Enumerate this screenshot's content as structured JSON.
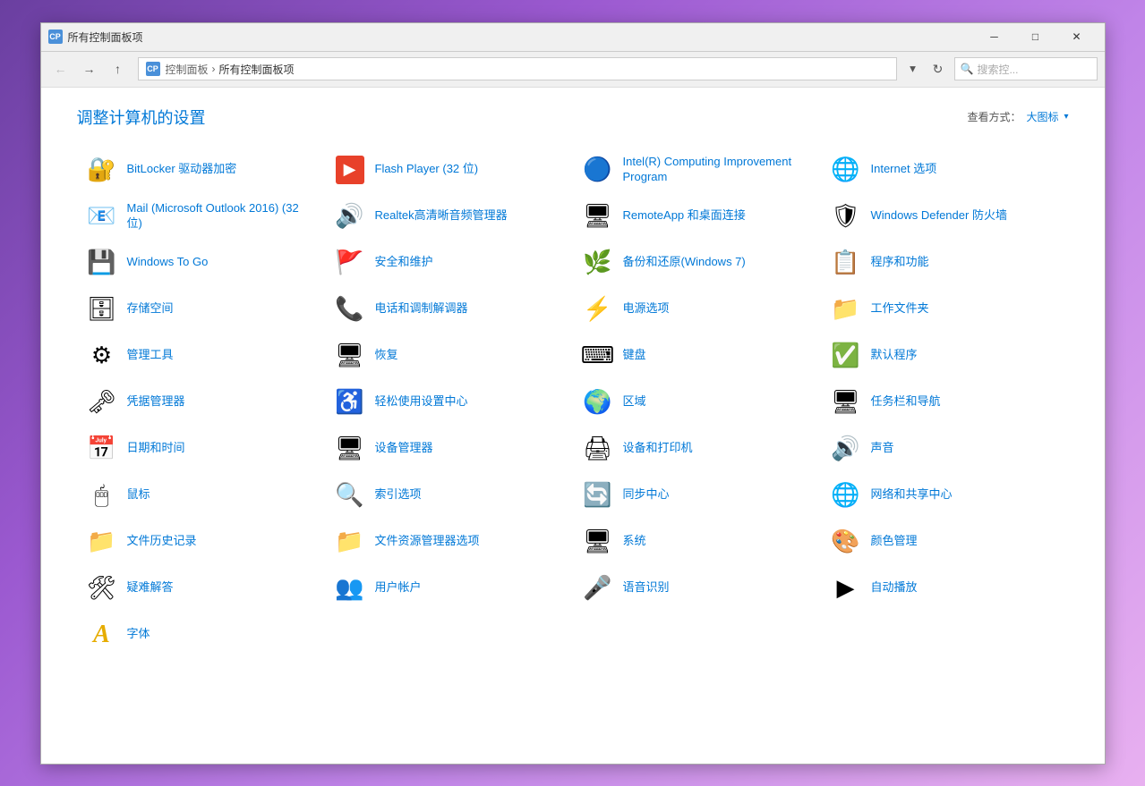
{
  "window": {
    "title": "所有控制面板项",
    "titlebar_icon": "CP"
  },
  "titlebar_buttons": {
    "minimize": "─",
    "maximize": "□",
    "close": "✕"
  },
  "toolbar": {
    "back": "←",
    "forward": "→",
    "up": "↑",
    "address_icon": "CP",
    "breadcrumb1": "控制面板",
    "breadcrumb2": "所有控制面板项",
    "dropdown": "▾",
    "refresh": "↻",
    "search_placeholder": "搜索控..."
  },
  "header": {
    "title": "调整计算机的设置",
    "view_label": "查看方式：",
    "view_mode": "大图标",
    "view_chevron": "▾"
  },
  "items": [
    {
      "label": "BitLocker 驱动器加密",
      "icon": "🔐",
      "icon_color": "#666"
    },
    {
      "label": "Flash Player (32 位)",
      "icon": "▶",
      "icon_color": "#e8412a",
      "icon_bg": "#e8412a"
    },
    {
      "label": "Intel(R) Computing Improvement Program",
      "icon": "🔵",
      "icon_color": "#0071c5"
    },
    {
      "label": "Internet 选项",
      "icon": "🌐",
      "icon_color": "#1e88e5"
    },
    {
      "label": "Mail (Microsoft Outlook 2016) (32 位)",
      "icon": "📧",
      "icon_color": "#0078d4"
    },
    {
      "label": "Realtek高清晰音频管理器",
      "icon": "🔊",
      "icon_color": "#e65c00"
    },
    {
      "label": "RemoteApp 和桌面连接",
      "icon": "🖥",
      "icon_color": "#0078d4"
    },
    {
      "label": "Windows Defender 防火墙",
      "icon": "🛡",
      "icon_color": "#d4a000"
    },
    {
      "label": "Windows To Go",
      "icon": "💾",
      "icon_color": "#0078d4"
    },
    {
      "label": "安全和维护",
      "icon": "🚩",
      "icon_color": "#cc0000"
    },
    {
      "label": "备份和还原(Windows 7)",
      "icon": "🌿",
      "icon_color": "#4caf50"
    },
    {
      "label": "程序和功能",
      "icon": "📋",
      "icon_color": "#888"
    },
    {
      "label": "存储空间",
      "icon": "🗄",
      "icon_color": "#0078d4"
    },
    {
      "label": "电话和调制解调器",
      "icon": "📞",
      "icon_color": "#666"
    },
    {
      "label": "电源选项",
      "icon": "⚡",
      "icon_color": "#4caf50"
    },
    {
      "label": "工作文件夹",
      "icon": "📁",
      "icon_color": "#e6ac00"
    },
    {
      "label": "管理工具",
      "icon": "⚙",
      "icon_color": "#666"
    },
    {
      "label": "恢复",
      "icon": "🖥",
      "icon_color": "#0078d4"
    },
    {
      "label": "键盘",
      "icon": "⌨",
      "icon_color": "#888"
    },
    {
      "label": "默认程序",
      "icon": "✅",
      "icon_color": "#4caf50"
    },
    {
      "label": "凭据管理器",
      "icon": "🗝",
      "icon_color": "#c8a800"
    },
    {
      "label": "轻松使用设置中心",
      "icon": "♿",
      "icon_color": "#0078d7"
    },
    {
      "label": "区域",
      "icon": "🌍",
      "icon_color": "#1e88e5"
    },
    {
      "label": "任务栏和导航",
      "icon": "🖥",
      "icon_color": "#555"
    },
    {
      "label": "日期和时间",
      "icon": "📅",
      "icon_color": "#0078d4"
    },
    {
      "label": "设备管理器",
      "icon": "🖥",
      "icon_color": "#0078d4"
    },
    {
      "label": "设备和打印机",
      "icon": "🖨",
      "icon_color": "#666"
    },
    {
      "label": "声音",
      "icon": "🔊",
      "icon_color": "#888"
    },
    {
      "label": "鼠标",
      "icon": "🖱",
      "icon_color": "#555"
    },
    {
      "label": "索引选项",
      "icon": "🔍",
      "icon_color": "#0078d4"
    },
    {
      "label": "同步中心",
      "icon": "🔄",
      "icon_color": "#4caf50"
    },
    {
      "label": "网络和共享中心",
      "icon": "🌐",
      "icon_color": "#0078d4"
    },
    {
      "label": "文件历史记录",
      "icon": "📁",
      "icon_color": "#e6ac00"
    },
    {
      "label": "文件资源管理器选项",
      "icon": "📁",
      "icon_color": "#e6ac00"
    },
    {
      "label": "系统",
      "icon": "🖥",
      "icon_color": "#0078d4"
    },
    {
      "label": "颜色管理",
      "icon": "🎨",
      "icon_color": "#4caf50"
    },
    {
      "label": "疑难解答",
      "icon": "🛠",
      "icon_color": "#666"
    },
    {
      "label": "用户帐户",
      "icon": "👥",
      "icon_color": "#e6ac00"
    },
    {
      "label": "语音识别",
      "icon": "🎤",
      "icon_color": "#888"
    },
    {
      "label": "自动播放",
      "icon": "▶",
      "icon_color": "#4caf50"
    },
    {
      "label": "字体",
      "icon": "A",
      "icon_color": "#e6ac00",
      "is_font": true
    }
  ]
}
